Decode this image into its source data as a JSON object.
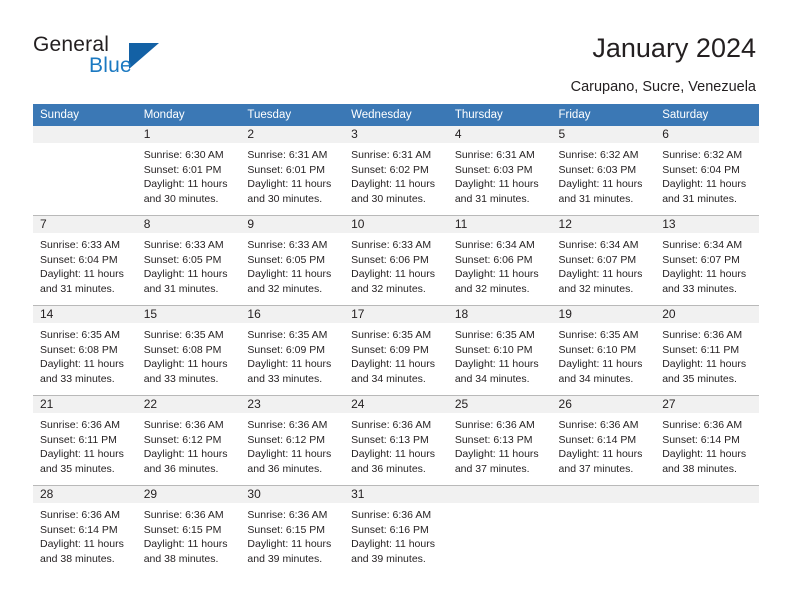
{
  "brand": {
    "word1": "General",
    "word2": "Blue",
    "triangle_color": "#1361a5",
    "blue_color": "#1b79c1"
  },
  "header": {
    "title": "January 2024",
    "subtitle": "Carupano, Sucre, Venezuela",
    "accent_color": "#3b78b5"
  },
  "calendar": {
    "weekday_headers": [
      "Sunday",
      "Monday",
      "Tuesday",
      "Wednesday",
      "Thursday",
      "Friday",
      "Saturday"
    ],
    "weeks": [
      [
        {
          "day": "",
          "sunrise": "",
          "sunset": "",
          "daylight_1": "",
          "daylight_2": ""
        },
        {
          "day": "1",
          "sunrise": "Sunrise: 6:30 AM",
          "sunset": "Sunset: 6:01 PM",
          "daylight_1": "Daylight: 11 hours",
          "daylight_2": "and 30 minutes."
        },
        {
          "day": "2",
          "sunrise": "Sunrise: 6:31 AM",
          "sunset": "Sunset: 6:01 PM",
          "daylight_1": "Daylight: 11 hours",
          "daylight_2": "and 30 minutes."
        },
        {
          "day": "3",
          "sunrise": "Sunrise: 6:31 AM",
          "sunset": "Sunset: 6:02 PM",
          "daylight_1": "Daylight: 11 hours",
          "daylight_2": "and 30 minutes."
        },
        {
          "day": "4",
          "sunrise": "Sunrise: 6:31 AM",
          "sunset": "Sunset: 6:03 PM",
          "daylight_1": "Daylight: 11 hours",
          "daylight_2": "and 31 minutes."
        },
        {
          "day": "5",
          "sunrise": "Sunrise: 6:32 AM",
          "sunset": "Sunset: 6:03 PM",
          "daylight_1": "Daylight: 11 hours",
          "daylight_2": "and 31 minutes."
        },
        {
          "day": "6",
          "sunrise": "Sunrise: 6:32 AM",
          "sunset": "Sunset: 6:04 PM",
          "daylight_1": "Daylight: 11 hours",
          "daylight_2": "and 31 minutes."
        }
      ],
      [
        {
          "day": "7",
          "sunrise": "Sunrise: 6:33 AM",
          "sunset": "Sunset: 6:04 PM",
          "daylight_1": "Daylight: 11 hours",
          "daylight_2": "and 31 minutes."
        },
        {
          "day": "8",
          "sunrise": "Sunrise: 6:33 AM",
          "sunset": "Sunset: 6:05 PM",
          "daylight_1": "Daylight: 11 hours",
          "daylight_2": "and 31 minutes."
        },
        {
          "day": "9",
          "sunrise": "Sunrise: 6:33 AM",
          "sunset": "Sunset: 6:05 PM",
          "daylight_1": "Daylight: 11 hours",
          "daylight_2": "and 32 minutes."
        },
        {
          "day": "10",
          "sunrise": "Sunrise: 6:33 AM",
          "sunset": "Sunset: 6:06 PM",
          "daylight_1": "Daylight: 11 hours",
          "daylight_2": "and 32 minutes."
        },
        {
          "day": "11",
          "sunrise": "Sunrise: 6:34 AM",
          "sunset": "Sunset: 6:06 PM",
          "daylight_1": "Daylight: 11 hours",
          "daylight_2": "and 32 minutes."
        },
        {
          "day": "12",
          "sunrise": "Sunrise: 6:34 AM",
          "sunset": "Sunset: 6:07 PM",
          "daylight_1": "Daylight: 11 hours",
          "daylight_2": "and 32 minutes."
        },
        {
          "day": "13",
          "sunrise": "Sunrise: 6:34 AM",
          "sunset": "Sunset: 6:07 PM",
          "daylight_1": "Daylight: 11 hours",
          "daylight_2": "and 33 minutes."
        }
      ],
      [
        {
          "day": "14",
          "sunrise": "Sunrise: 6:35 AM",
          "sunset": "Sunset: 6:08 PM",
          "daylight_1": "Daylight: 11 hours",
          "daylight_2": "and 33 minutes."
        },
        {
          "day": "15",
          "sunrise": "Sunrise: 6:35 AM",
          "sunset": "Sunset: 6:08 PM",
          "daylight_1": "Daylight: 11 hours",
          "daylight_2": "and 33 minutes."
        },
        {
          "day": "16",
          "sunrise": "Sunrise: 6:35 AM",
          "sunset": "Sunset: 6:09 PM",
          "daylight_1": "Daylight: 11 hours",
          "daylight_2": "and 33 minutes."
        },
        {
          "day": "17",
          "sunrise": "Sunrise: 6:35 AM",
          "sunset": "Sunset: 6:09 PM",
          "daylight_1": "Daylight: 11 hours",
          "daylight_2": "and 34 minutes."
        },
        {
          "day": "18",
          "sunrise": "Sunrise: 6:35 AM",
          "sunset": "Sunset: 6:10 PM",
          "daylight_1": "Daylight: 11 hours",
          "daylight_2": "and 34 minutes."
        },
        {
          "day": "19",
          "sunrise": "Sunrise: 6:35 AM",
          "sunset": "Sunset: 6:10 PM",
          "daylight_1": "Daylight: 11 hours",
          "daylight_2": "and 34 minutes."
        },
        {
          "day": "20",
          "sunrise": "Sunrise: 6:36 AM",
          "sunset": "Sunset: 6:11 PM",
          "daylight_1": "Daylight: 11 hours",
          "daylight_2": "and 35 minutes."
        }
      ],
      [
        {
          "day": "21",
          "sunrise": "Sunrise: 6:36 AM",
          "sunset": "Sunset: 6:11 PM",
          "daylight_1": "Daylight: 11 hours",
          "daylight_2": "and 35 minutes."
        },
        {
          "day": "22",
          "sunrise": "Sunrise: 6:36 AM",
          "sunset": "Sunset: 6:12 PM",
          "daylight_1": "Daylight: 11 hours",
          "daylight_2": "and 36 minutes."
        },
        {
          "day": "23",
          "sunrise": "Sunrise: 6:36 AM",
          "sunset": "Sunset: 6:12 PM",
          "daylight_1": "Daylight: 11 hours",
          "daylight_2": "and 36 minutes."
        },
        {
          "day": "24",
          "sunrise": "Sunrise: 6:36 AM",
          "sunset": "Sunset: 6:13 PM",
          "daylight_1": "Daylight: 11 hours",
          "daylight_2": "and 36 minutes."
        },
        {
          "day": "25",
          "sunrise": "Sunrise: 6:36 AM",
          "sunset": "Sunset: 6:13 PM",
          "daylight_1": "Daylight: 11 hours",
          "daylight_2": "and 37 minutes."
        },
        {
          "day": "26",
          "sunrise": "Sunrise: 6:36 AM",
          "sunset": "Sunset: 6:14 PM",
          "daylight_1": "Daylight: 11 hours",
          "daylight_2": "and 37 minutes."
        },
        {
          "day": "27",
          "sunrise": "Sunrise: 6:36 AM",
          "sunset": "Sunset: 6:14 PM",
          "daylight_1": "Daylight: 11 hours",
          "daylight_2": "and 38 minutes."
        }
      ],
      [
        {
          "day": "28",
          "sunrise": "Sunrise: 6:36 AM",
          "sunset": "Sunset: 6:14 PM",
          "daylight_1": "Daylight: 11 hours",
          "daylight_2": "and 38 minutes."
        },
        {
          "day": "29",
          "sunrise": "Sunrise: 6:36 AM",
          "sunset": "Sunset: 6:15 PM",
          "daylight_1": "Daylight: 11 hours",
          "daylight_2": "and 38 minutes."
        },
        {
          "day": "30",
          "sunrise": "Sunrise: 6:36 AM",
          "sunset": "Sunset: 6:15 PM",
          "daylight_1": "Daylight: 11 hours",
          "daylight_2": "and 39 minutes."
        },
        {
          "day": "31",
          "sunrise": "Sunrise: 6:36 AM",
          "sunset": "Sunset: 6:16 PM",
          "daylight_1": "Daylight: 11 hours",
          "daylight_2": "and 39 minutes."
        },
        {
          "day": "",
          "sunrise": "",
          "sunset": "",
          "daylight_1": "",
          "daylight_2": ""
        },
        {
          "day": "",
          "sunrise": "",
          "sunset": "",
          "daylight_1": "",
          "daylight_2": ""
        },
        {
          "day": "",
          "sunrise": "",
          "sunset": "",
          "daylight_1": "",
          "daylight_2": ""
        }
      ]
    ]
  }
}
